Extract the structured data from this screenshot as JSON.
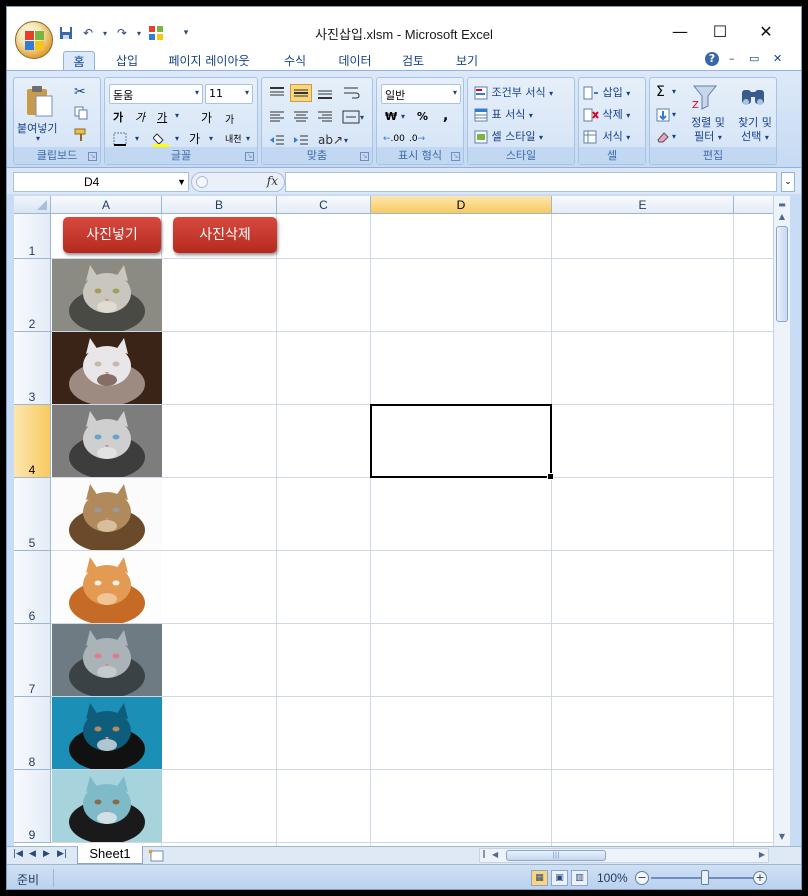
{
  "window": {
    "title": "사진삽입.xlsm - Microsoft Excel",
    "minimize": "—",
    "maximize": "☐",
    "close": "✕"
  },
  "qat": {
    "dropdown": "▾"
  },
  "ribbon": {
    "tabs": [
      {
        "label": "홈",
        "active": true
      },
      {
        "label": "삽입"
      },
      {
        "label": "페이지 레이아웃"
      },
      {
        "label": "수식"
      },
      {
        "label": "데이터"
      },
      {
        "label": "검토"
      },
      {
        "label": "보기"
      }
    ],
    "help_icon": "?",
    "clipboard": {
      "label": "클립보드",
      "paste": "붙여넣기"
    },
    "font": {
      "label": "글꼴",
      "font_name": "돋움",
      "font_size": "11",
      "grow": "가",
      "shrink": "가",
      "bold": "가",
      "italic": "가",
      "underline": "가",
      "phonetic": "내천"
    },
    "alignment": {
      "label": "맞춤"
    },
    "number": {
      "label": "표시 형식",
      "format": "일반",
      "currency": "₩",
      "percent": "%",
      "comma": ",",
      "inc_decimal": ".00",
      "dec_decimal": ".0"
    },
    "styles": {
      "label": "스타일",
      "conditional": "조건부 서식",
      "table": "표 서식",
      "cell": "셀 스타일"
    },
    "cells": {
      "label": "셀",
      "insert": "삽입",
      "delete": "삭제",
      "format": "서식"
    },
    "editing": {
      "label": "편집",
      "sort_line1": "정렬 및",
      "sort_line2": "필터",
      "find_line1": "찾기 및",
      "find_line2": "선택"
    }
  },
  "formula_bar": {
    "name_box": "D4",
    "fx": "fx",
    "formula": ""
  },
  "sheet": {
    "columns": [
      "A",
      "B",
      "C",
      "D",
      "E"
    ],
    "rows": [
      "1",
      "2",
      "3",
      "4",
      "5",
      "6",
      "7",
      "8",
      "9"
    ],
    "selected_column": "D",
    "selected_row": "4",
    "buttons": {
      "insert_photo": "사진넣기",
      "delete_photo": "사진삭제"
    },
    "photos": [
      "cat-licking",
      "white-kitten",
      "gray-cat",
      "tabby-kitten-lying",
      "orange-kitten",
      "cat-tongue",
      "cat-on-dog",
      "dog-and-cat"
    ]
  },
  "tabs_bar": {
    "sheet_name": "Sheet1"
  },
  "status": {
    "ready": "준비",
    "zoom": "100%"
  },
  "colors": {
    "accent": "#15428b",
    "macro_button": "#c0392b",
    "selection": "#f8c95f"
  }
}
